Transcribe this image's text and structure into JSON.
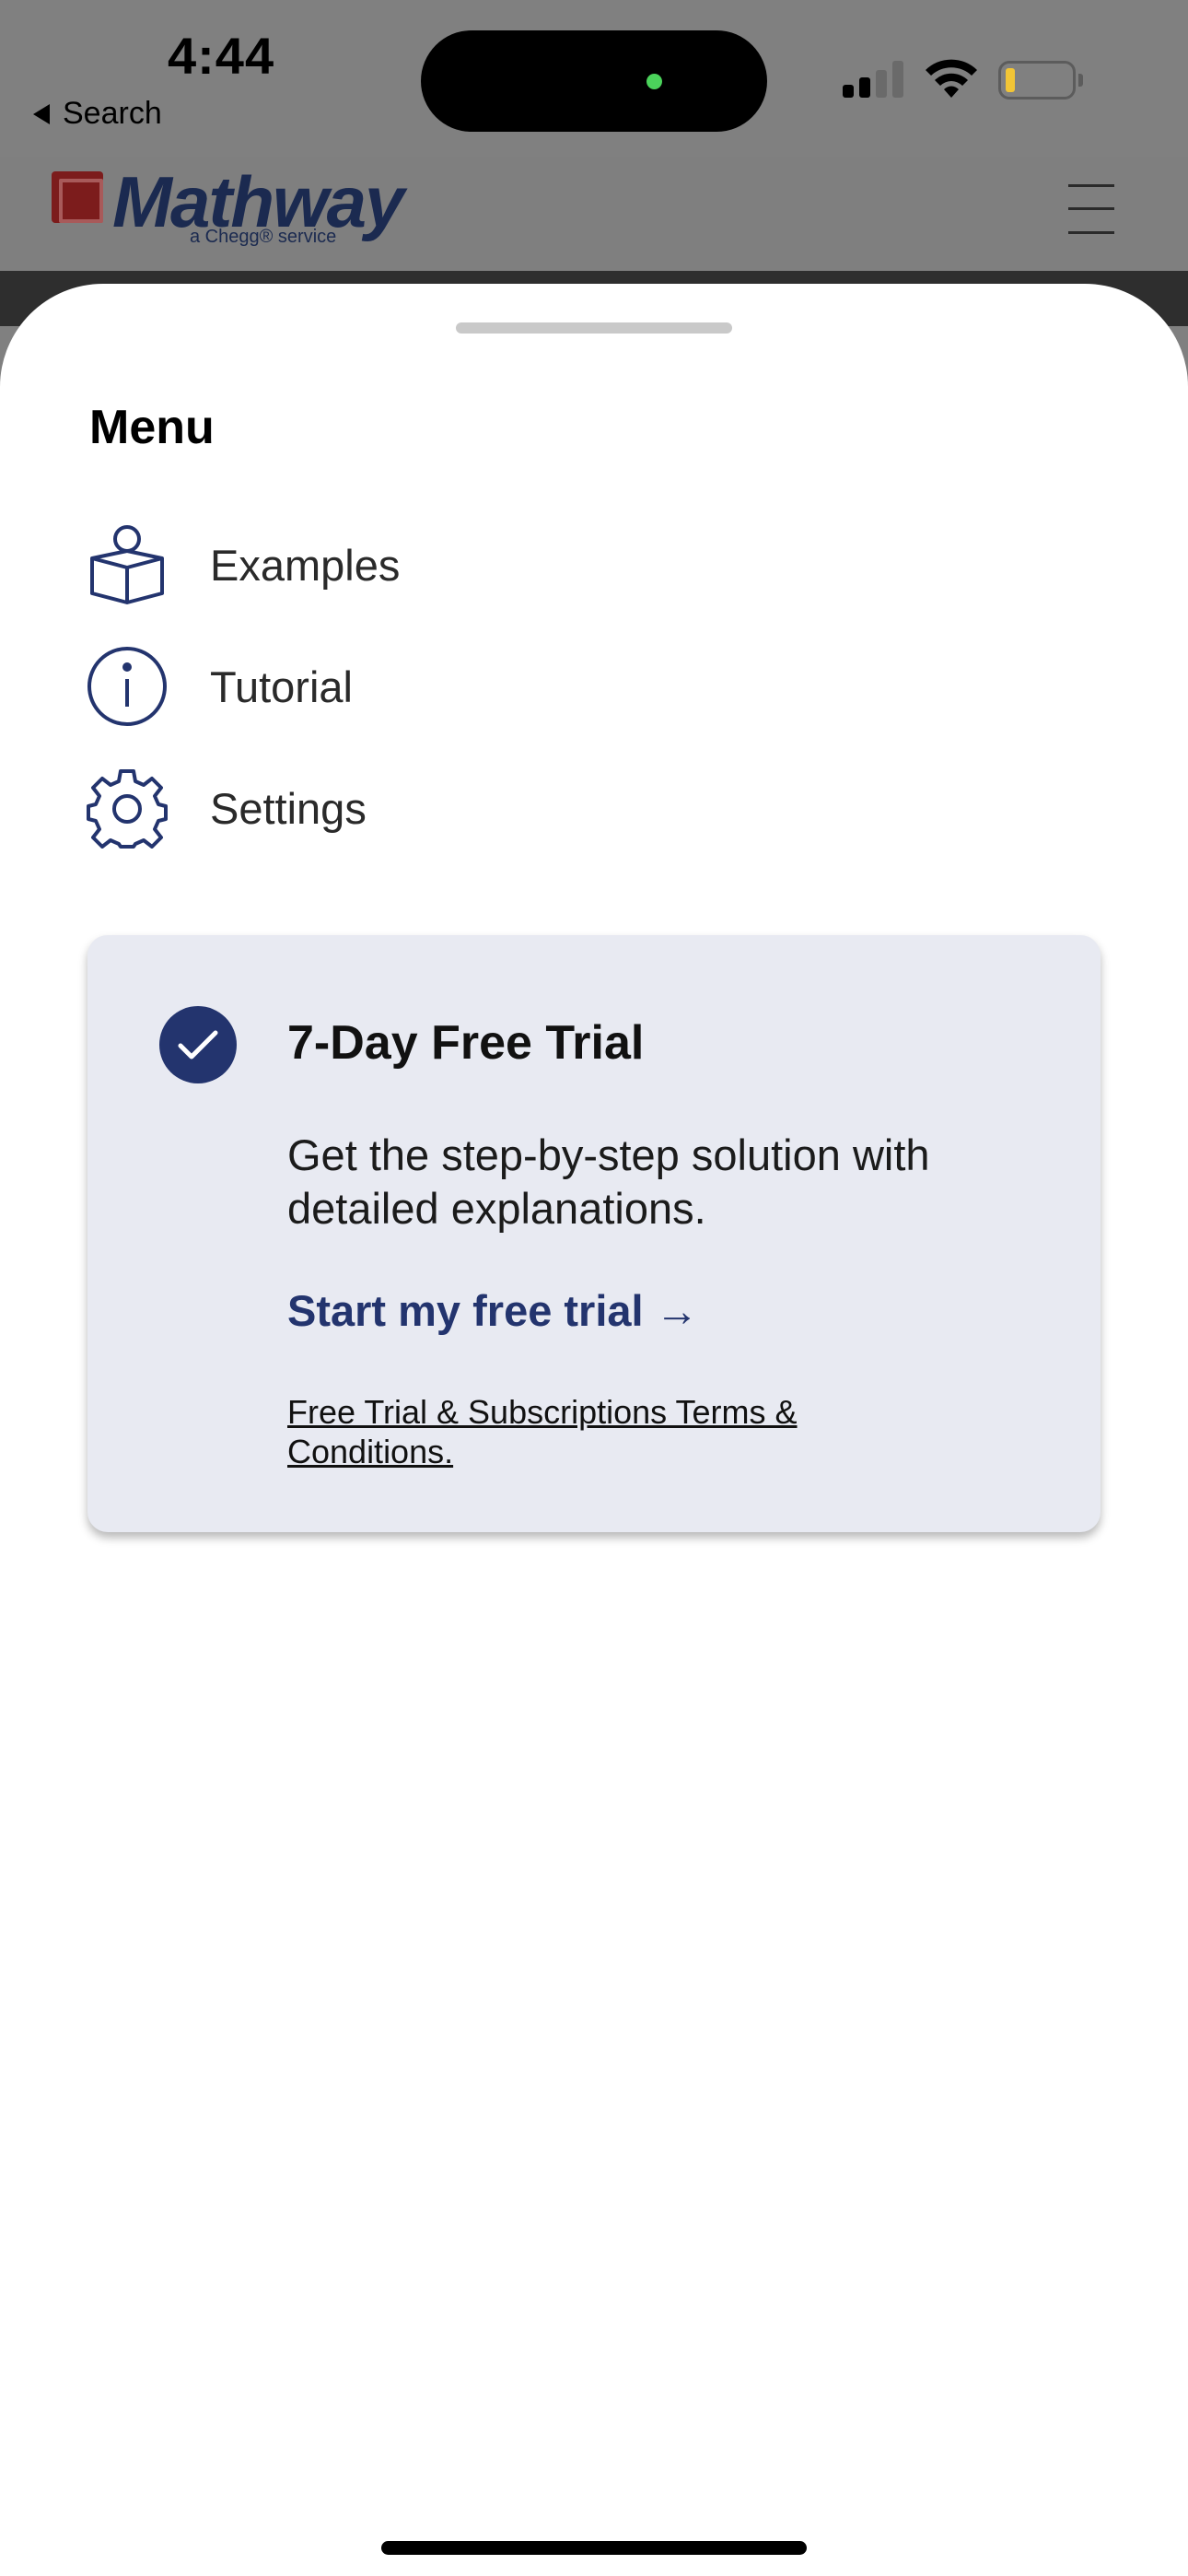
{
  "status_bar": {
    "time": "4:44",
    "back_label": "Search",
    "signal_bars_active": 2,
    "signal_bars_total": 4,
    "battery_level": 0.1,
    "battery_color": "#f2c535",
    "camera_indicator_color": "#4bd35b"
  },
  "header": {
    "logo_text": "Mathway",
    "logo_subtext": "a Chegg® service",
    "menu_icon": "hamburger-icon"
  },
  "sheet": {
    "title": "Menu",
    "items": [
      {
        "label": "Examples",
        "icon": "book-reader-icon"
      },
      {
        "label": "Tutorial",
        "icon": "info-icon"
      },
      {
        "label": "Settings",
        "icon": "gear-icon"
      }
    ]
  },
  "trial_card": {
    "icon": "check-circle-icon",
    "title": "7-Day Free Trial",
    "description": "Get the step-by-step solution with detailed explanations.",
    "cta": "Start my free trial →",
    "terms": "Free Trial & Subscriptions Terms & Conditions."
  },
  "colors": {
    "accent": "#23346e",
    "card_background": "#e8eaf2",
    "logo_blue": "#1b2a50",
    "logo_red": "#7c1c1c"
  }
}
